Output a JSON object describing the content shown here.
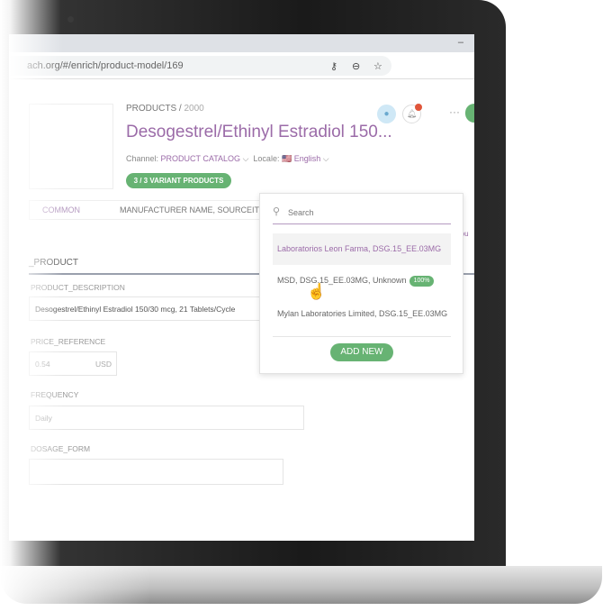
{
  "browser": {
    "url": "ach.org/#/enrich/product-model/169",
    "minimize": "–",
    "icons": [
      "key-icon",
      "zoom-out-icon",
      "star-icon"
    ]
  },
  "header": {
    "breadcrumb_root": "PRODUCTS /",
    "breadcrumb_id": "2000",
    "title": "Desogestrel/Ethinyl Estradiol 150...",
    "channel_label": "Channel:",
    "channel_value": "PRODUCT CATALOG",
    "locale_label": "Locale:",
    "locale_flag": "🇺🇸",
    "locale_value": "English",
    "variant_badge": "3 / 3 VARIANT PRODUCTS",
    "more": "···"
  },
  "tabs": {
    "common": "COMMON",
    "current": "MANUFACTURER NAME, SOURCEITE..."
  },
  "partial_link": "tribu",
  "section": "_PRODUCT",
  "fields": [
    {
      "label": "PRODUCT_DESCRIPTION",
      "value": "Desogestrel/Ethinyl Estradiol 150/30 mcg, 21 Tablets/Cycle"
    },
    {
      "label": "PRICE_REFERENCE",
      "value": "0.54",
      "unit": "USD"
    },
    {
      "label": "FREQUENCY",
      "value": "Daily"
    },
    {
      "label": "DOSAGE_FORM",
      "value": ""
    }
  ],
  "dropdown": {
    "search_placeholder": "Search",
    "options": [
      {
        "label": "Laboratorios Leon Farma, DSG.15_EE.03MG",
        "highlighted": true
      },
      {
        "label": "MSD, DSG.15_EE.03MG, Unknown",
        "badge": "100%"
      },
      {
        "label": "Mylan Laboratories Limited, DSG.15_EE.03MG"
      }
    ],
    "add_new": "ADD NEW"
  },
  "colors": {
    "accent": "#9b6ba8",
    "green": "#67b373",
    "notification": "#e0553a"
  }
}
